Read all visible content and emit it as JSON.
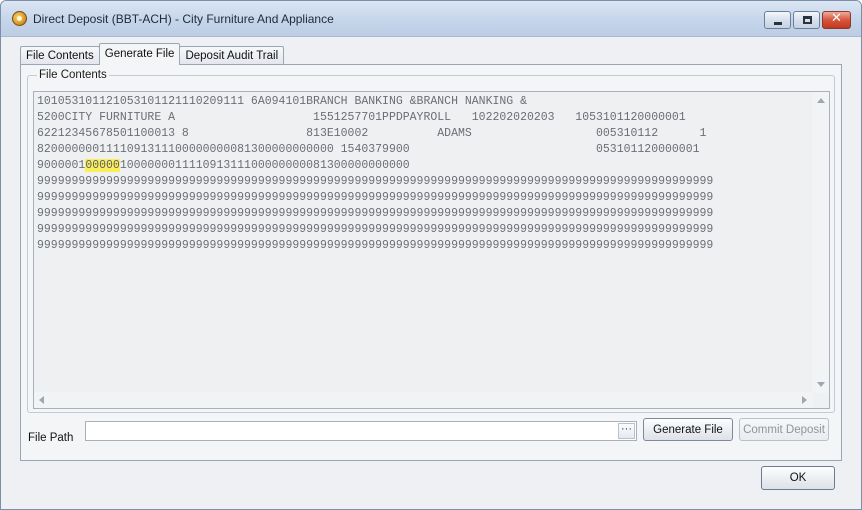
{
  "window": {
    "title": "Direct Deposit (BBT-ACH) - City Furniture And Appliance",
    "app_icon": "coin-icon",
    "close_glyph": "✕"
  },
  "tabs": [
    {
      "label": "File Contents",
      "active": false
    },
    {
      "label": "Generate File",
      "active": true
    },
    {
      "label": "Deposit Audit Trail",
      "active": false
    }
  ],
  "panel": {
    "group_label": "File Contents",
    "file_lines": [
      "101053101121053101121110209111 6A094101BRANCH BANKING &BRANCH NANKING &",
      "5200CITY FURNITURE A                    1551257701PPDPAYROLL   102202020203   1053101120000001",
      "62212345678501100013 8                 813E10002          ADAMS                  005310112      1",
      "8200000001111091311100000000081300000000000 1540379900                           053101120000001",
      "9000001",
      "99999999999999999999999999999999999999999999999999999999999999999999999999999999999999999999999999",
      "99999999999999999999999999999999999999999999999999999999999999999999999999999999999999999999999999",
      "99999999999999999999999999999999999999999999999999999999999999999999999999999999999999999999999999",
      "99999999999999999999999999999999999999999999999999999999999999999999999999999999999999999999999999",
      "99999999999999999999999999999999999999999999999999999999999999999999999999999999999999999999999999"
    ],
    "line5_highlight": "00000",
    "line5_rest": "100000001111091311100000000081300000000000"
  },
  "file_path": {
    "label": "File Path",
    "value": "",
    "browse_label": "···"
  },
  "buttons": {
    "generate": "Generate File",
    "commit": "Commit Deposit",
    "ok": "OK"
  },
  "colors": {
    "highlight": "#fbee5c",
    "close_button": "#d7553c"
  }
}
